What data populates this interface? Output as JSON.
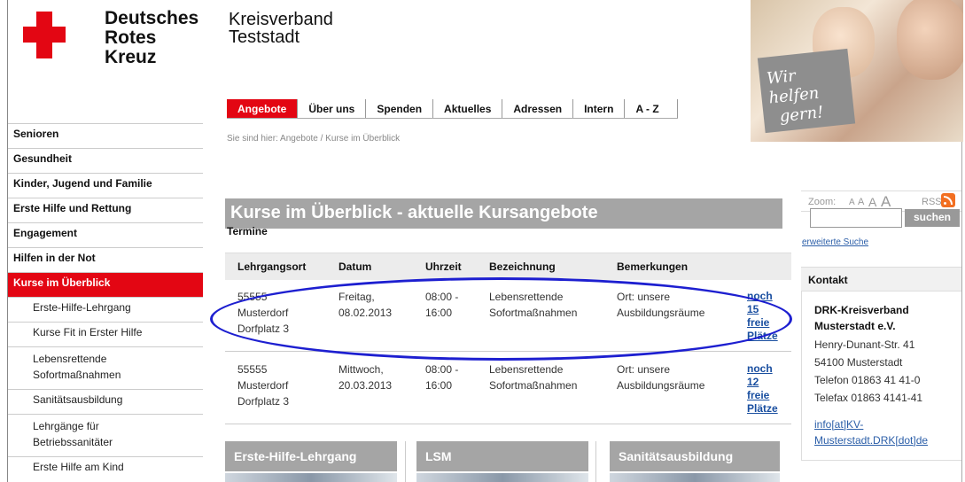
{
  "logo": {
    "line1": "Deutsches",
    "line2": "Rotes",
    "line3": "Kreuz"
  },
  "org": {
    "line1": "Kreisverband",
    "line2": "Teststadt"
  },
  "header_image": {
    "slogan_line1": "Wir helfen",
    "slogan_line2": "gern!"
  },
  "topnav": [
    "Angebote",
    "Über uns",
    "Spenden",
    "Aktuelles",
    "Adressen",
    "Intern",
    "A - Z"
  ],
  "breadcrumb": "Sie sind hier: Angebote / Kurse im Überblick",
  "sidebar": {
    "items": [
      "Senioren",
      "Gesundheit",
      "Kinder, Jugend und Familie",
      "Erste Hilfe und Rettung",
      "Engagement",
      "Hilfen in der Not",
      "Kurse im Überblick"
    ],
    "subitems": [
      "Erste-Hilfe-Lehrgang",
      "Kurse Fit in Erster Hilfe",
      "Lebensrettende",
      "Sofortmaßnahmen",
      "Sanitätsausbildung",
      "Lehrgänge für",
      "Betriebssanitäter",
      "Erste Hilfe am Kind"
    ]
  },
  "main": {
    "headline": "Kurse im Überblick - aktuelle Kursangebote",
    "section_title": "Termine",
    "table": {
      "headers": [
        "Lehrgangsort",
        "Datum",
        "Uhrzeit",
        "Bezeichnung",
        "Bemerkungen"
      ],
      "rows": [
        {
          "ort": [
            "55555",
            "Musterdorf",
            "Dorfplatz 3"
          ],
          "datum": [
            "Freitag,",
            "08.02.2013"
          ],
          "zeit": [
            "08:00 -",
            "16:00"
          ],
          "bez": [
            "Lebensrettende",
            "Sofortmaßnahmen"
          ],
          "bem": [
            "Ort: unsere",
            "Ausbildungsräume"
          ],
          "link": [
            "noch",
            "15",
            "freie",
            "Plätze"
          ]
        },
        {
          "ort": [
            "55555",
            "Musterdorf",
            "Dorfplatz 3"
          ],
          "datum": [
            "Mittwoch,",
            "20.03.2013"
          ],
          "zeit": [
            "08:00 -",
            "16:00"
          ],
          "bez": [
            "Lebensrettende",
            "Sofortmaßnahmen"
          ],
          "bem": [
            "Ort: unsere",
            "Ausbildungsräume"
          ],
          "link": [
            "noch",
            "12",
            "freie",
            "Plätze"
          ]
        }
      ]
    },
    "cards": [
      "Erste-Hilfe-Lehrgang",
      "LSM",
      "Sanitätsausbildung"
    ]
  },
  "right": {
    "zoom_label": "Zoom:",
    "zoom_letters": [
      "A",
      "A",
      "A",
      "A"
    ],
    "rss_label": "RSS:",
    "search_button": "suchen",
    "search_value": "",
    "advanced_search": "erweiterte Suche",
    "kontakt_title": "Kontakt",
    "kontakt": {
      "name1": "DRK-Kreisverband",
      "name2": "Musterstadt e.V.",
      "street": "Henry-Dunant-Str. 41",
      "city": "54100 Musterstadt",
      "phone": "Telefon 01863 41 41-0",
      "fax": "Telefax 01863 4141-41",
      "mail1": "info[at]KV-",
      "mail2": "Musterstadt.DRK[dot]de"
    }
  },
  "colors": {
    "red": "#e30613",
    "gray_bar": "#a5a5a5",
    "link": "#1a4fa0",
    "annotation": "#1d1fd0"
  }
}
